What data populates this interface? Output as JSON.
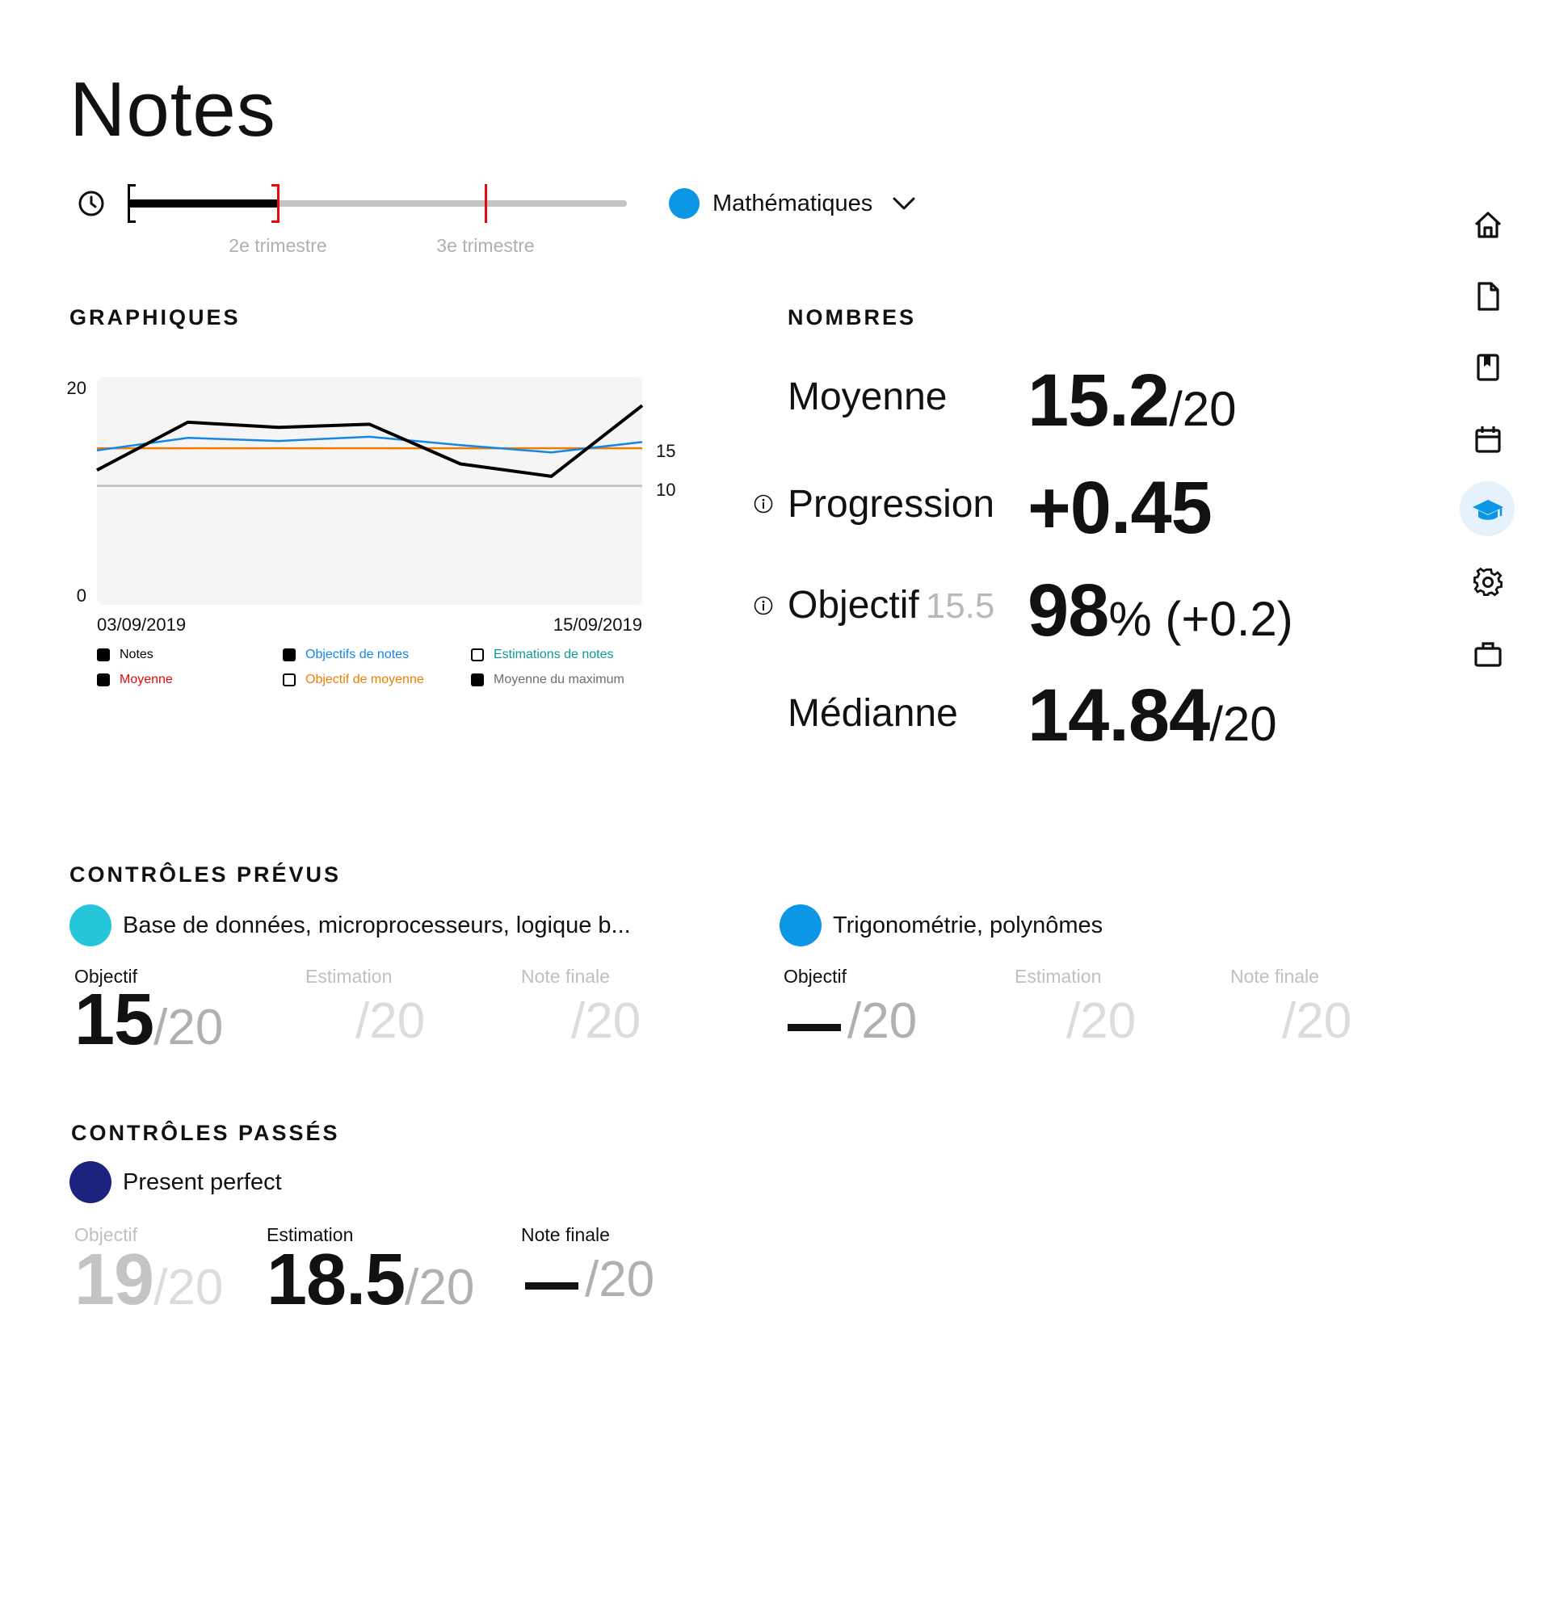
{
  "header": {
    "title": "Notes"
  },
  "timeline": {
    "labels": [
      "2e trimestre",
      "3e trimestre"
    ],
    "progress_fraction": 0.3
  },
  "subject": {
    "name": "Mathématiques",
    "color": "#0b96e6"
  },
  "graphiques": {
    "heading": "GRAPHIQUES",
    "legend": [
      {
        "label": "Notes",
        "checked": true,
        "color": "#000000"
      },
      {
        "label": "Moyenne",
        "checked": true,
        "color": "#e10b0b"
      },
      {
        "label": "Objectifs de notes",
        "checked": true,
        "color": "#1487e6"
      },
      {
        "label": "Objectif de moyenne",
        "checked": false,
        "color": "#f07d00"
      },
      {
        "label": "Estimations de notes",
        "checked": false,
        "color": "#0e9a92"
      },
      {
        "label": "Moyenne du maximum",
        "checked": true,
        "color": "#6e6e6e"
      }
    ]
  },
  "chart_data": {
    "type": "line",
    "x_start_label": "03/09/2019",
    "x_end_label": "15/09/2019",
    "x": [
      0,
      1,
      2,
      3,
      4,
      5,
      6
    ],
    "ylim": [
      0,
      20
    ],
    "left_ticks": [
      "20",
      "0"
    ],
    "right_ticks": [
      "15",
      "10"
    ],
    "grid": false,
    "series": [
      {
        "name": "Notes",
        "color": "#000000",
        "width": 4,
        "values": [
          12.0,
          16.6,
          16.1,
          16.4,
          12.6,
          11.4,
          18.2
        ]
      },
      {
        "name": "Objectifs de notes",
        "color": "#1487e6",
        "width": 2.5,
        "values": [
          13.9,
          15.1,
          14.8,
          15.2,
          14.4,
          13.7,
          14.7
        ]
      },
      {
        "name": "Objectif de moyenne",
        "color": "#f07d00",
        "width": 2.5,
        "values": [
          14.1,
          14.1,
          14.1,
          14.1,
          14.1,
          14.1,
          14.1
        ]
      },
      {
        "name": "Moyenne du maximum",
        "color": "#bdbdbd",
        "width": 2.5,
        "values": [
          10.5,
          10.5,
          10.5,
          10.5,
          10.5,
          10.5,
          10.5
        ]
      }
    ]
  },
  "nombres": {
    "heading": "NOMBRES",
    "moyenne": {
      "label": "Moyenne",
      "value": "15.2",
      "unit": "/20"
    },
    "progression": {
      "label": "Progression",
      "value": "+0.45"
    },
    "objectif": {
      "label": "Objectif",
      "target": "15.5",
      "value": "98",
      "unit": "% (+0.2)"
    },
    "medianne": {
      "label": "Médianne",
      "value": "14.84",
      "unit": "/20"
    }
  },
  "controles_prevus": {
    "heading": "CONTRÔLES PRÉVUS",
    "items": [
      {
        "title": "Base de données, microprocesseurs, logique b...",
        "color": "#26c6da",
        "objectif_label": "Objectif",
        "objectif_value": "15",
        "objectif_den": "/20",
        "estimation_label": "Estimation",
        "estimation_value": "",
        "estimation_den": "/20",
        "finale_label": "Note finale",
        "finale_value": "",
        "finale_den": "/20"
      },
      {
        "title": "Trigonométrie, polynômes",
        "color": "#0b96e6",
        "objectif_label": "Objectif",
        "objectif_value": "",
        "objectif_den": "/20",
        "estimation_label": "Estimation",
        "estimation_value": "",
        "estimation_den": "/20",
        "finale_label": "Note finale",
        "finale_value": "",
        "finale_den": "/20"
      }
    ]
  },
  "controles_passes": {
    "heading": "CONTRÔLES PASSÉS",
    "items": [
      {
        "title": "Present perfect",
        "color": "#1a237e",
        "objectif_label": "Objectif",
        "objectif_value": "19",
        "objectif_den": "/20",
        "estimation_label": "Estimation",
        "estimation_value": "18.5",
        "estimation_den": "/20",
        "finale_label": "Note finale",
        "finale_value": "",
        "finale_den": "/20"
      }
    ]
  },
  "sidebar": {
    "items": [
      {
        "icon": "home-icon",
        "active": false
      },
      {
        "icon": "document-icon",
        "active": false
      },
      {
        "icon": "bookmark-book-icon",
        "active": false
      },
      {
        "icon": "calendar-icon",
        "active": false
      },
      {
        "icon": "graduation-cap-icon",
        "active": true
      },
      {
        "icon": "gear-icon",
        "active": false
      },
      {
        "icon": "briefcase-icon",
        "active": false
      }
    ],
    "active_color": "#0b96e6"
  }
}
